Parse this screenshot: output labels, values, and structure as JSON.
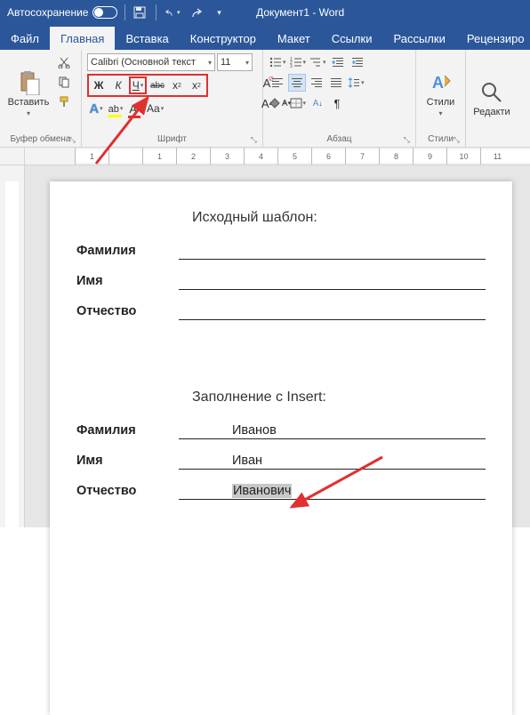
{
  "titlebar": {
    "autosave": "Автосохранение",
    "doc": "Документ1 - Word"
  },
  "tabs": {
    "file": "Файл",
    "home": "Главная",
    "insert": "Вставка",
    "design": "Конструктор",
    "layout": "Макет",
    "references": "Ссылки",
    "mailings": "Рассылки",
    "review": "Рецензиро"
  },
  "ribbon": {
    "clipboard": {
      "paste": "Вставить",
      "label": "Буфер обмена"
    },
    "font": {
      "name": "Calibri (Основной текст",
      "size": "11",
      "bold": "Ж",
      "italic": "К",
      "underline": "Ч",
      "strike": "abc",
      "sub": "x",
      "sup": "x",
      "grow": "A",
      "shrink": "A",
      "case": "Aa",
      "clear": "A",
      "label": "Шрифт"
    },
    "para": {
      "label": "Абзац"
    },
    "styles": {
      "btn": "Стили",
      "label": "Стили"
    },
    "editing": {
      "btn": "Редакти"
    }
  },
  "doc": {
    "h1": "Исходный шаблон:",
    "lastname": "Фамилия",
    "firstname": "Имя",
    "patronymic": "Отчество",
    "h2": "Заполнение с Insert:",
    "val_last": "Иванов",
    "val_first": "Иван",
    "val_patr": "Иванович"
  },
  "ruler": [
    "1",
    "",
    "1",
    "2",
    "3",
    "4",
    "5",
    "6",
    "7",
    "8",
    "9",
    "10",
    "11"
  ]
}
